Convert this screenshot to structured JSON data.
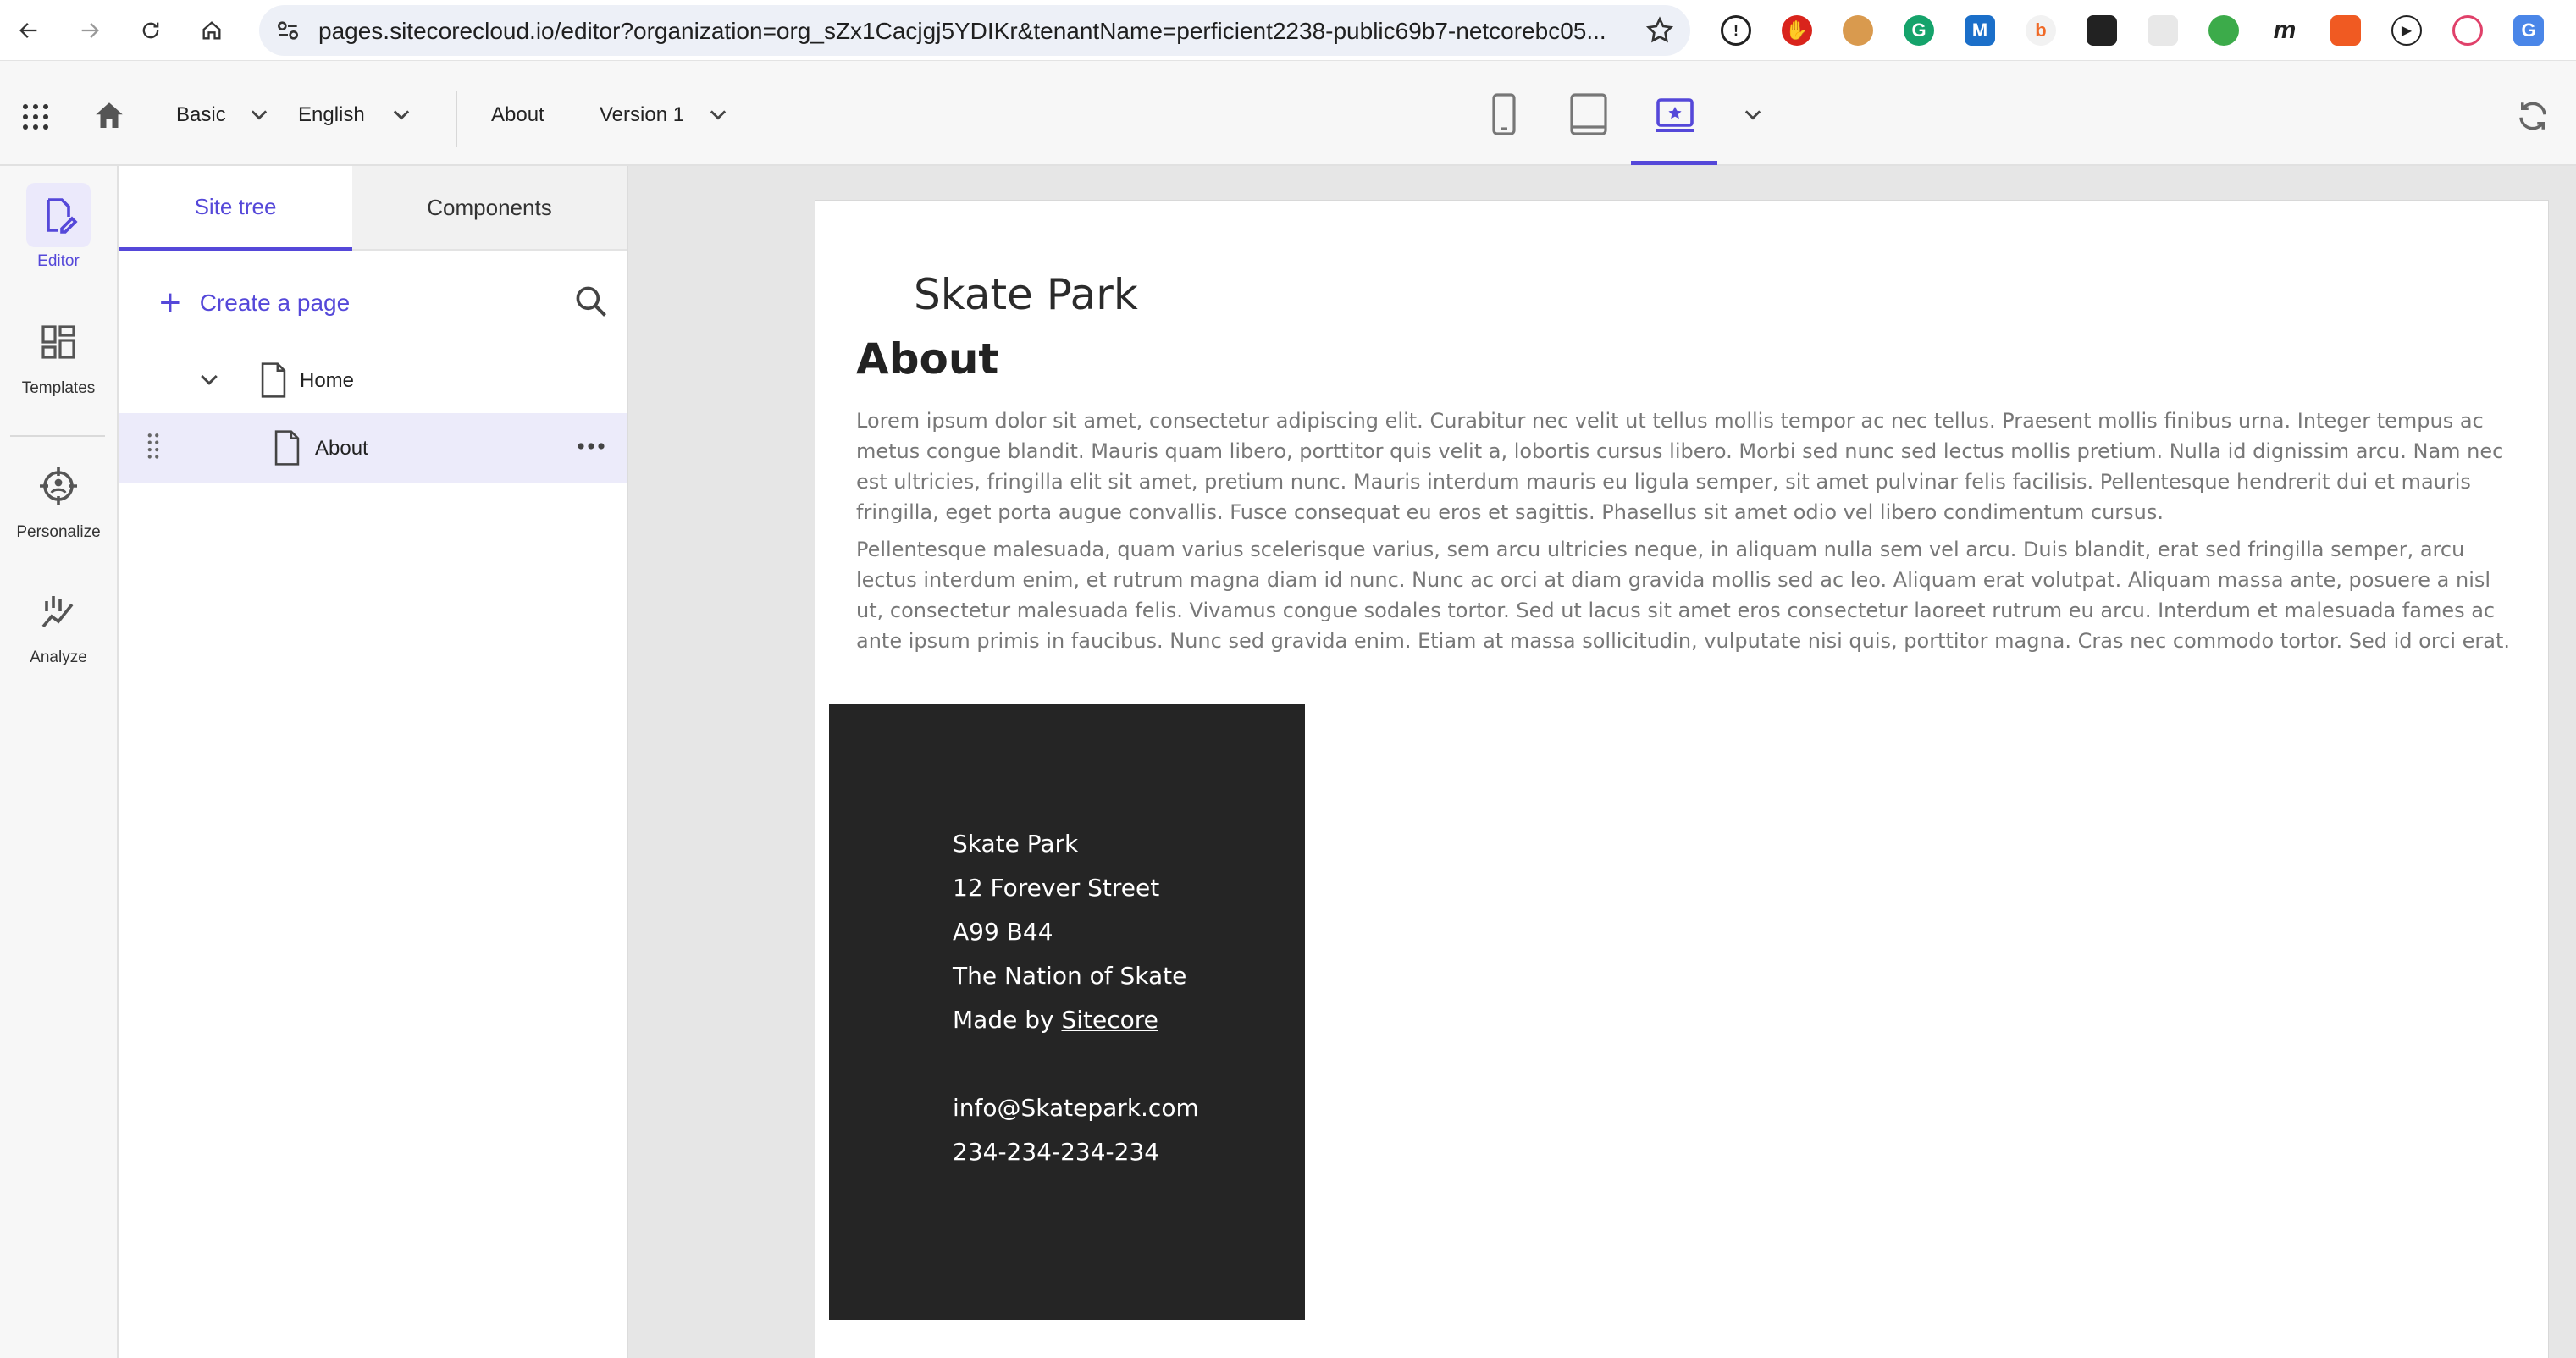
{
  "browser": {
    "url": "pages.sitecorecloud.io/editor?organization=org_sZx1Cacjgj5YDIKr&tenantName=perficient2238-public69b7-netcorebc05..."
  },
  "header": {
    "template_name": "Basic",
    "language": "English",
    "page_name": "About",
    "version": "Version 1"
  },
  "rail": {
    "items": [
      {
        "label": "Editor",
        "icon": "editor-icon"
      },
      {
        "label": "Templates",
        "icon": "templates-icon"
      },
      {
        "label": "Personalize",
        "icon": "personalize-icon"
      },
      {
        "label": "Analyze",
        "icon": "analyze-icon"
      }
    ]
  },
  "tree": {
    "tabs": [
      "Site tree",
      "Components"
    ],
    "create_label": "Create a page",
    "nodes": [
      {
        "label": "Home"
      },
      {
        "label": "About"
      }
    ]
  },
  "page": {
    "site_title": "Skate Park",
    "heading": "About",
    "paragraphs": [
      "Lorem ipsum dolor sit amet, consectetur adipiscing elit. Curabitur nec velit ut tellus mollis tempor ac nec tellus. Praesent mollis finibus urna. Integer tempus ac metus congue blandit. Mauris quam libero, porttitor quis velit a, lobortis cursus libero. Morbi sed nunc sed lectus mollis pretium. Nulla id dignissim arcu. Nam nec est ultricies, fringilla elit sit amet, pretium nunc. Mauris interdum mauris eu ligula semper, sit amet pulvinar felis facilisis. Pellentesque hendrerit dui et mauris fringilla, eget porta augue convallis. Fusce consequat eu eros et sagittis. Phasellus sit amet odio vel libero condimentum cursus.",
      "Pellentesque malesuada, quam varius scelerisque varius, sem arcu ultricies neque, in aliquam nulla sem vel arcu. Duis blandit, erat sed fringilla semper, arcu lectus interdum enim, et rutrum magna diam id nunc. Nunc ac orci at diam gravida mollis sed ac leo. Aliquam erat volutpat. Aliquam massa ante, posuere a nisl ut, consectetur malesuada felis. Vivamus congue sodales tortor. Sed ut lacus sit amet eros consectetur laoreet rutrum eu arcu. Interdum et malesuada fames ac ante ipsum primis in faucibus. Nunc sed gravida enim. Etiam at massa sollicitudin, vulputate nisi quis, porttitor magna. Cras nec commodo tortor. Sed id orci erat."
    ],
    "footer": {
      "name": "Skate Park",
      "street": "12 Forever Street",
      "postcode": "A99 B44",
      "country": "The Nation of Skate",
      "made_by_prefix": "Made by ",
      "made_by_link": "Sitecore",
      "email": "info@Skatepark.com",
      "phone": "234-234-234-234"
    }
  },
  "colors": {
    "accent": "#5548d9",
    "footer_bg": "#252525"
  }
}
